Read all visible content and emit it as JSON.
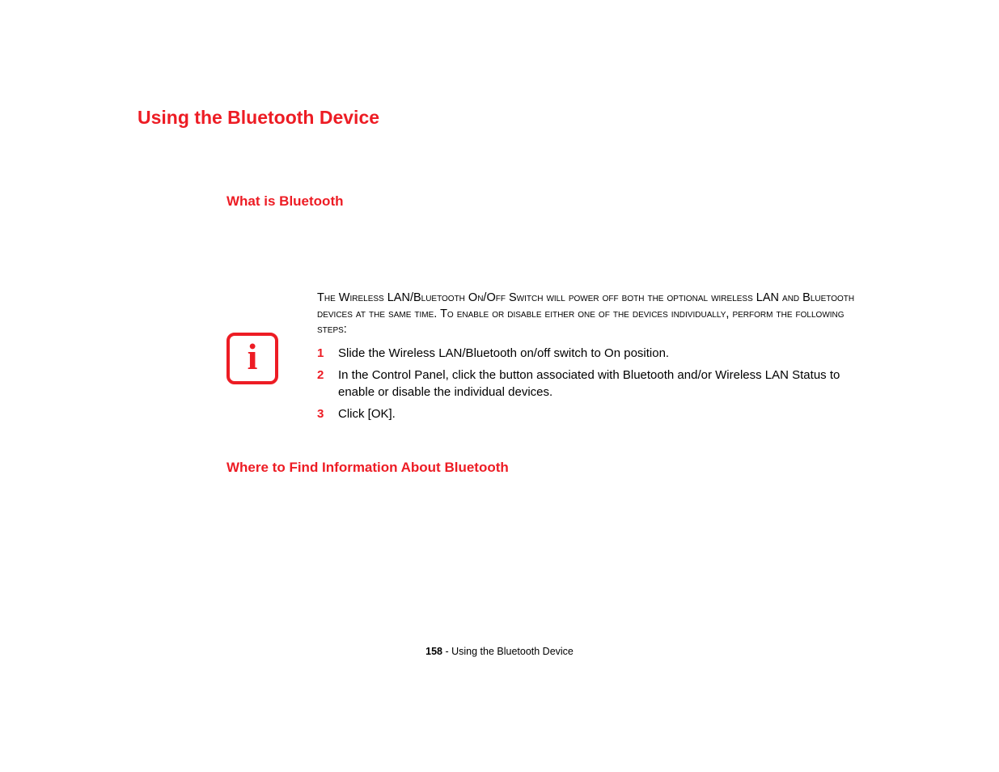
{
  "title": "Using the Bluetooth Device",
  "section1": {
    "heading": "What is Bluetooth"
  },
  "infobox": {
    "intro": "The Wireless LAN/Bluetooth On/Off Switch will power off both the optional wireless LAN and Bluetooth devices at the same time. To enable or disable either one of the devices individually, perform the following steps:",
    "steps": [
      {
        "num": "1",
        "text": "Slide the Wireless LAN/Bluetooth on/off switch to On position."
      },
      {
        "num": "2",
        "text": "In the Control Panel, click the button associated with Bluetooth and/or Wireless LAN Status to enable or disable the individual devices."
      },
      {
        "num": "3",
        "text": "Click [OK]."
      }
    ]
  },
  "section2": {
    "heading": "Where to Find Information About Bluetooth"
  },
  "footer": {
    "page": "158",
    "sep": " - ",
    "label": "Using the Bluetooth Device"
  }
}
